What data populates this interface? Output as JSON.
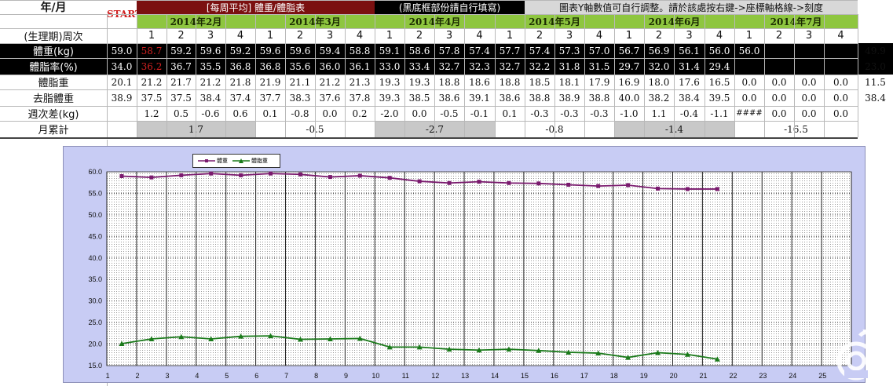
{
  "header": {
    "year_month": "年/月",
    "cycle_week": "(生理期)周次",
    "start": "START",
    "banner_left": "[每周平均] 體重/體脂表",
    "banner_mid": "(黑底框部份請自行填寫)",
    "banner_right": "圖表Y軸數值可自行調整。請於該處按右鍵->座標軸格線->刻度"
  },
  "months": [
    "2014年2月",
    "2014年3月",
    "2014年4月",
    "2014年5月",
    "2014年6月",
    "2014年7月"
  ],
  "weeks": [
    "1",
    "2",
    "3",
    "4"
  ],
  "rows": [
    {
      "label": "體重(kg)",
      "vals": [
        "59.0",
        "58.7",
        "59.2",
        "59.6",
        "59.2",
        "59.6",
        "59.6",
        "59.4",
        "58.8",
        "59.1",
        "58.6",
        "57.8",
        "57.4",
        "57.7",
        "57.4",
        "57.3",
        "57.0",
        "56.7",
        "56.9",
        "56.1",
        "56.0",
        "56.0",
        "",
        "",
        "",
        ""
      ],
      "extra": "49.9"
    },
    {
      "label": "體脂率(%)",
      "vals": [
        "34.0",
        "36.2",
        "36.7",
        "35.5",
        "36.8",
        "36.8",
        "35.6",
        "36.0",
        "36.1",
        "33.0",
        "33.4",
        "32.7",
        "32.3",
        "32.7",
        "32.2",
        "31.8",
        "31.5",
        "29.7",
        "32.0",
        "31.4",
        "29.4",
        "",
        "",
        "",
        "",
        ""
      ],
      "extra": "23.0"
    },
    {
      "label": "體脂重",
      "vals": [
        "20.1",
        "21.2",
        "21.7",
        "21.2",
        "21.8",
        "21.9",
        "21.1",
        "21.2",
        "21.3",
        "19.3",
        "19.3",
        "18.8",
        "18.6",
        "18.8",
        "18.5",
        "18.1",
        "17.9",
        "16.9",
        "18.0",
        "17.6",
        "16.5",
        "0.0",
        "0.0",
        "0.0",
        "0.0",
        ""
      ],
      "extra": "11.5"
    },
    {
      "label": "去脂體重",
      "vals": [
        "38.9",
        "37.5",
        "37.5",
        "38.4",
        "37.4",
        "37.7",
        "38.3",
        "37.6",
        "37.8",
        "39.3",
        "38.5",
        "38.6",
        "39.1",
        "38.6",
        "38.8",
        "38.9",
        "38.8",
        "40.0",
        "38.2",
        "38.4",
        "39.5",
        "0.0",
        "0.0",
        "0.0",
        "0.0",
        ""
      ],
      "extra": "38.4"
    },
    {
      "label": "週次差(kg)",
      "vals": [
        "",
        "1.2",
        "0.5",
        "-0.6",
        "0.6",
        "0.1",
        "-0.8",
        "0.0",
        "0.2",
        "-2.0",
        "0.0",
        "-0.5",
        "-0.1",
        "0.1",
        "-0.3",
        "-0.3",
        "-0.3",
        "-1.0",
        "1.1",
        "-0.4",
        "-1.1",
        "####",
        "0.0",
        "0.0",
        "0.0",
        ""
      ],
      "extra": ""
    }
  ],
  "monthly": {
    "label": "月累計",
    "values": [
      "1.7",
      "-0.5",
      "-2.7",
      "-0.8",
      "-1.4",
      "-16.5"
    ]
  },
  "colors": {
    "banner_dark_red": "#7b1010",
    "banner_black": "#000000",
    "banner_gray": "#d8d8d8",
    "month_green": "#8ec63f",
    "start_red": "#d02020",
    "chart_bg": "#c8ccf4",
    "weight_line": "#7a1a6e",
    "fat_line": "#1a7a1a"
  },
  "chart_data": {
    "type": "line",
    "categories": [
      "1",
      "2",
      "3",
      "4",
      "5",
      "6",
      "7",
      "8",
      "9",
      "10",
      "11",
      "12",
      "13",
      "14",
      "15",
      "16",
      "17",
      "18",
      "19",
      "20",
      "21",
      "22",
      "23",
      "24",
      "25"
    ],
    "series": [
      {
        "name": "體重",
        "values": [
          59.0,
          58.7,
          59.2,
          59.6,
          59.2,
          59.6,
          59.4,
          58.8,
          59.1,
          58.6,
          57.8,
          57.4,
          57.7,
          57.4,
          57.3,
          57.0,
          56.7,
          56.9,
          56.1,
          56.0,
          56.0
        ]
      },
      {
        "name": "體脂重",
        "values": [
          20.1,
          21.2,
          21.7,
          21.2,
          21.8,
          21.9,
          21.1,
          21.2,
          21.3,
          19.3,
          19.3,
          18.8,
          18.6,
          18.8,
          18.5,
          18.1,
          17.9,
          16.9,
          18.0,
          17.6,
          16.5
        ]
      }
    ],
    "yticks": [
      "15.0",
      "20.0",
      "25.0",
      "30.0",
      "35.0",
      "40.0",
      "45.0",
      "50.0",
      "55.0",
      "60.0"
    ],
    "ylim": [
      15,
      60
    ],
    "grid": true
  }
}
